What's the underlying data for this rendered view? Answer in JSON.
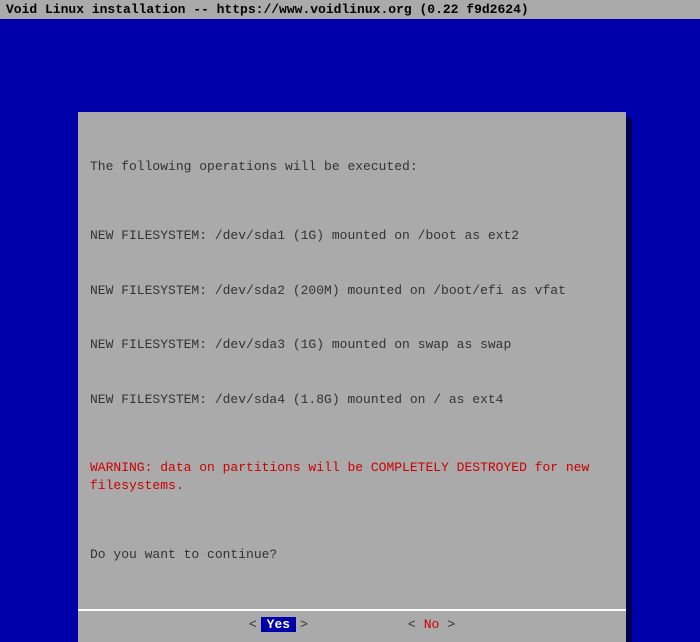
{
  "titlebar": {
    "text": "Void Linux installation -- https://www.voidlinux.org (0.22 f9d2624)"
  },
  "dialog": {
    "intro": "The following operations will be executed:",
    "filesystems": [
      "NEW FILESYSTEM: /dev/sda1 (1G) mounted on /boot as ext2",
      "NEW FILESYSTEM: /dev/sda2 (200M) mounted on /boot/efi as vfat",
      "NEW FILESYSTEM: /dev/sda3 (1G) mounted on swap as swap",
      "NEW FILESYSTEM: /dev/sda4 (1.8G) mounted on / as ext4"
    ],
    "warning": "WARNING: data on partitions will be COMPLETELY DESTROYED for new filesystems.",
    "prompt": "Do you want to continue?"
  },
  "buttons": {
    "yes": "Yes",
    "no": "No",
    "angle_open": "<",
    "angle_close": ">"
  }
}
